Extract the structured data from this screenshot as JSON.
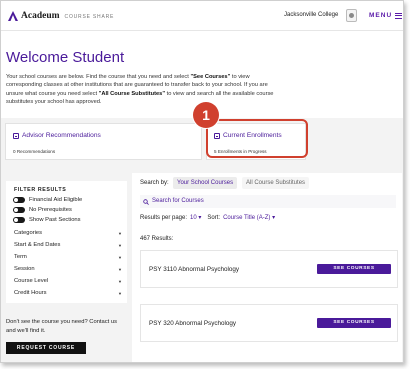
{
  "header": {
    "brand": "Acadeum",
    "brand_sub": "COURSE SHARE",
    "college": "Jacksonville College",
    "menu_label": "MENU"
  },
  "welcome": {
    "title": "Welcome Student",
    "intro_1": "Your school courses are below. Find the course that you need and select ",
    "intro_see": "\"See Courses\"",
    "intro_2": " to view corresponding classes at other institutions that are guaranteed to transfer back to your school. If you are unsure what course you need select ",
    "intro_all": "\"All Course Substitutes\"",
    "intro_3": " to view and search all the available course substitutes your school has approved."
  },
  "cards": [
    {
      "title": "Advisor Recommendations",
      "subtitle": "0 Recommendations"
    },
    {
      "title": "Current Enrollments",
      "subtitle": "5 Enrollments in Progress"
    }
  ],
  "callout": {
    "number": "1",
    "color": "#d0402e"
  },
  "filters": {
    "title": "FILTER RESULTS",
    "toggles": [
      "Financial Aid Eligible",
      "No Prerequisites",
      "Show Past Sections"
    ],
    "dropdowns": [
      "Categories",
      "Start & End Dates",
      "Term",
      "Session",
      "Course Level",
      "Credit Hours"
    ]
  },
  "help": {
    "text": "Don't see the course you need? Contact us and we'll find it.",
    "button": "REQUEST COURSE"
  },
  "search": {
    "label": "Search by:",
    "tabs": [
      "Your School Courses",
      "All Course Substitutes"
    ],
    "link": "Search for Courses",
    "per_page_label": "Results per page:",
    "per_page_value": "10",
    "sort_label": "Sort:",
    "sort_value": "Course Title (A-Z)",
    "results_count": "467 Results:"
  },
  "courses": [
    {
      "name": "PSY 3110 Abnormal Psychology",
      "button": "SEE COURSES"
    },
    {
      "name": "PSY 320 Abnormal Psychology",
      "button": "SEE COURSES"
    }
  ],
  "colors": {
    "accent": "#4a1a9a",
    "callout": "#d0402e"
  }
}
